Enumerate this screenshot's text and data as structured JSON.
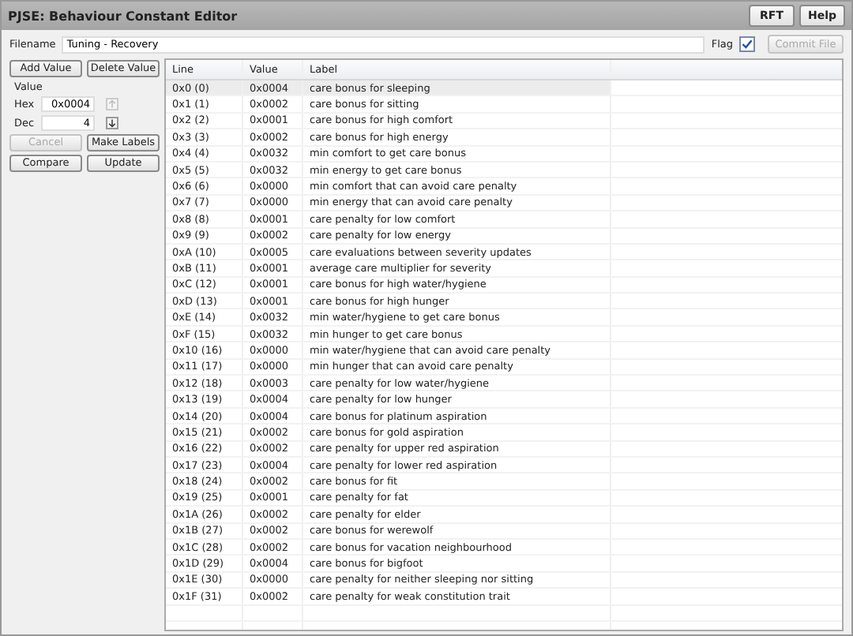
{
  "window": {
    "title": "PJSE: Behaviour Constant Editor",
    "buttons": [
      {
        "label": "RFT"
      },
      {
        "label": "Help"
      }
    ]
  },
  "file": {
    "label": "Filename",
    "value": "Tuning - Recovery",
    "flag_label": "Flag",
    "flag_checked": true,
    "commit": {
      "label": "Commit File",
      "disabled": true
    }
  },
  "left": {
    "add": "Add Value",
    "delete": "Delete Value",
    "group": "Value",
    "hex_label": "Hex",
    "hex": "0x0004",
    "dec_label": "Dec",
    "dec": "4",
    "up_disabled": true,
    "down_disabled": false,
    "cancel": {
      "label": "Cancel",
      "disabled": true
    },
    "make_labels": {
      "label": "Make Labels",
      "disabled": false
    },
    "compare": "Compare",
    "update": "Update"
  },
  "table": {
    "columns": [
      "Line",
      "Value",
      "Label"
    ],
    "rows": [
      {
        "line": "0x0 (0)",
        "value": "0x0004",
        "label": "care bonus for sleeping",
        "selected": true
      },
      {
        "line": "0x1 (1)",
        "value": "0x0002",
        "label": "care bonus for sitting",
        "selected": false
      },
      {
        "line": "0x2 (2)",
        "value": "0x0001",
        "label": "care bonus for high comfort",
        "selected": false
      },
      {
        "line": "0x3 (3)",
        "value": "0x0002",
        "label": "care bonus for high energy",
        "selected": false
      },
      {
        "line": "0x4 (4)",
        "value": "0x0032",
        "label": "min comfort to get care bonus",
        "selected": false
      },
      {
        "line": "0x5 (5)",
        "value": "0x0032",
        "label": "min energy to get care bonus",
        "selected": false
      },
      {
        "line": "0x6 (6)",
        "value": "0x0000",
        "label": "min comfort that can avoid care penalty",
        "selected": false
      },
      {
        "line": "0x7 (7)",
        "value": "0x0000",
        "label": "min energy that can avoid care penalty",
        "selected": false
      },
      {
        "line": "0x8 (8)",
        "value": "0x0001",
        "label": "care penalty for low comfort",
        "selected": false
      },
      {
        "line": "0x9 (9)",
        "value": "0x0002",
        "label": "care penalty for low energy",
        "selected": false
      },
      {
        "line": "0xA (10)",
        "value": "0x0005",
        "label": "care evaluations between severity updates",
        "selected": false
      },
      {
        "line": "0xB (11)",
        "value": "0x0001",
        "label": "average care multiplier for severity",
        "selected": false
      },
      {
        "line": "0xC (12)",
        "value": "0x0001",
        "label": "care bonus for high water/hygiene",
        "selected": false
      },
      {
        "line": "0xD (13)",
        "value": "0x0001",
        "label": "care bonus for high hunger",
        "selected": false
      },
      {
        "line": "0xE (14)",
        "value": "0x0032",
        "label": "min water/hygiene to get care bonus",
        "selected": false
      },
      {
        "line": "0xF (15)",
        "value": "0x0032",
        "label": "min hunger to get care bonus",
        "selected": false
      },
      {
        "line": "0x10 (16)",
        "value": "0x0000",
        "label": "min water/hygiene that can avoid care penalty",
        "selected": false
      },
      {
        "line": "0x11 (17)",
        "value": "0x0000",
        "label": "min hunger that can avoid care penalty",
        "selected": false
      },
      {
        "line": "0x12 (18)",
        "value": "0x0003",
        "label": "care penalty for low water/hygiene",
        "selected": false
      },
      {
        "line": "0x13 (19)",
        "value": "0x0004",
        "label": "care penalty for low hunger",
        "selected": false
      },
      {
        "line": "0x14 (20)",
        "value": "0x0004",
        "label": "care bonus for platinum aspiration",
        "selected": false
      },
      {
        "line": "0x15 (21)",
        "value": "0x0002",
        "label": "care bonus for gold aspiration",
        "selected": false
      },
      {
        "line": "0x16 (22)",
        "value": "0x0002",
        "label": "care penalty for upper red aspiration",
        "selected": false
      },
      {
        "line": "0x17 (23)",
        "value": "0x0004",
        "label": "care penalty for lower red aspiration",
        "selected": false
      },
      {
        "line": "0x18 (24)",
        "value": "0x0002",
        "label": "care bonus for fit",
        "selected": false
      },
      {
        "line": "0x19 (25)",
        "value": "0x0001",
        "label": "care penalty for fat",
        "selected": false
      },
      {
        "line": "0x1A (26)",
        "value": "0x0002",
        "label": "care penalty for elder",
        "selected": false
      },
      {
        "line": "0x1B (27)",
        "value": "0x0002",
        "label": "care bonus for werewolf",
        "selected": false
      },
      {
        "line": "0x1C (28)",
        "value": "0x0002",
        "label": "care bonus for vacation neighbourhood",
        "selected": false
      },
      {
        "line": "0x1D (29)",
        "value": "0x0004",
        "label": "care bonus for bigfoot",
        "selected": false
      },
      {
        "line": "0x1E (30)",
        "value": "0x0000",
        "label": "care penalty for neither sleeping nor sitting",
        "selected": false
      },
      {
        "line": "0x1F (31)",
        "value": "0x0002",
        "label": "care penalty for weak constitution trait",
        "selected": false
      }
    ]
  }
}
